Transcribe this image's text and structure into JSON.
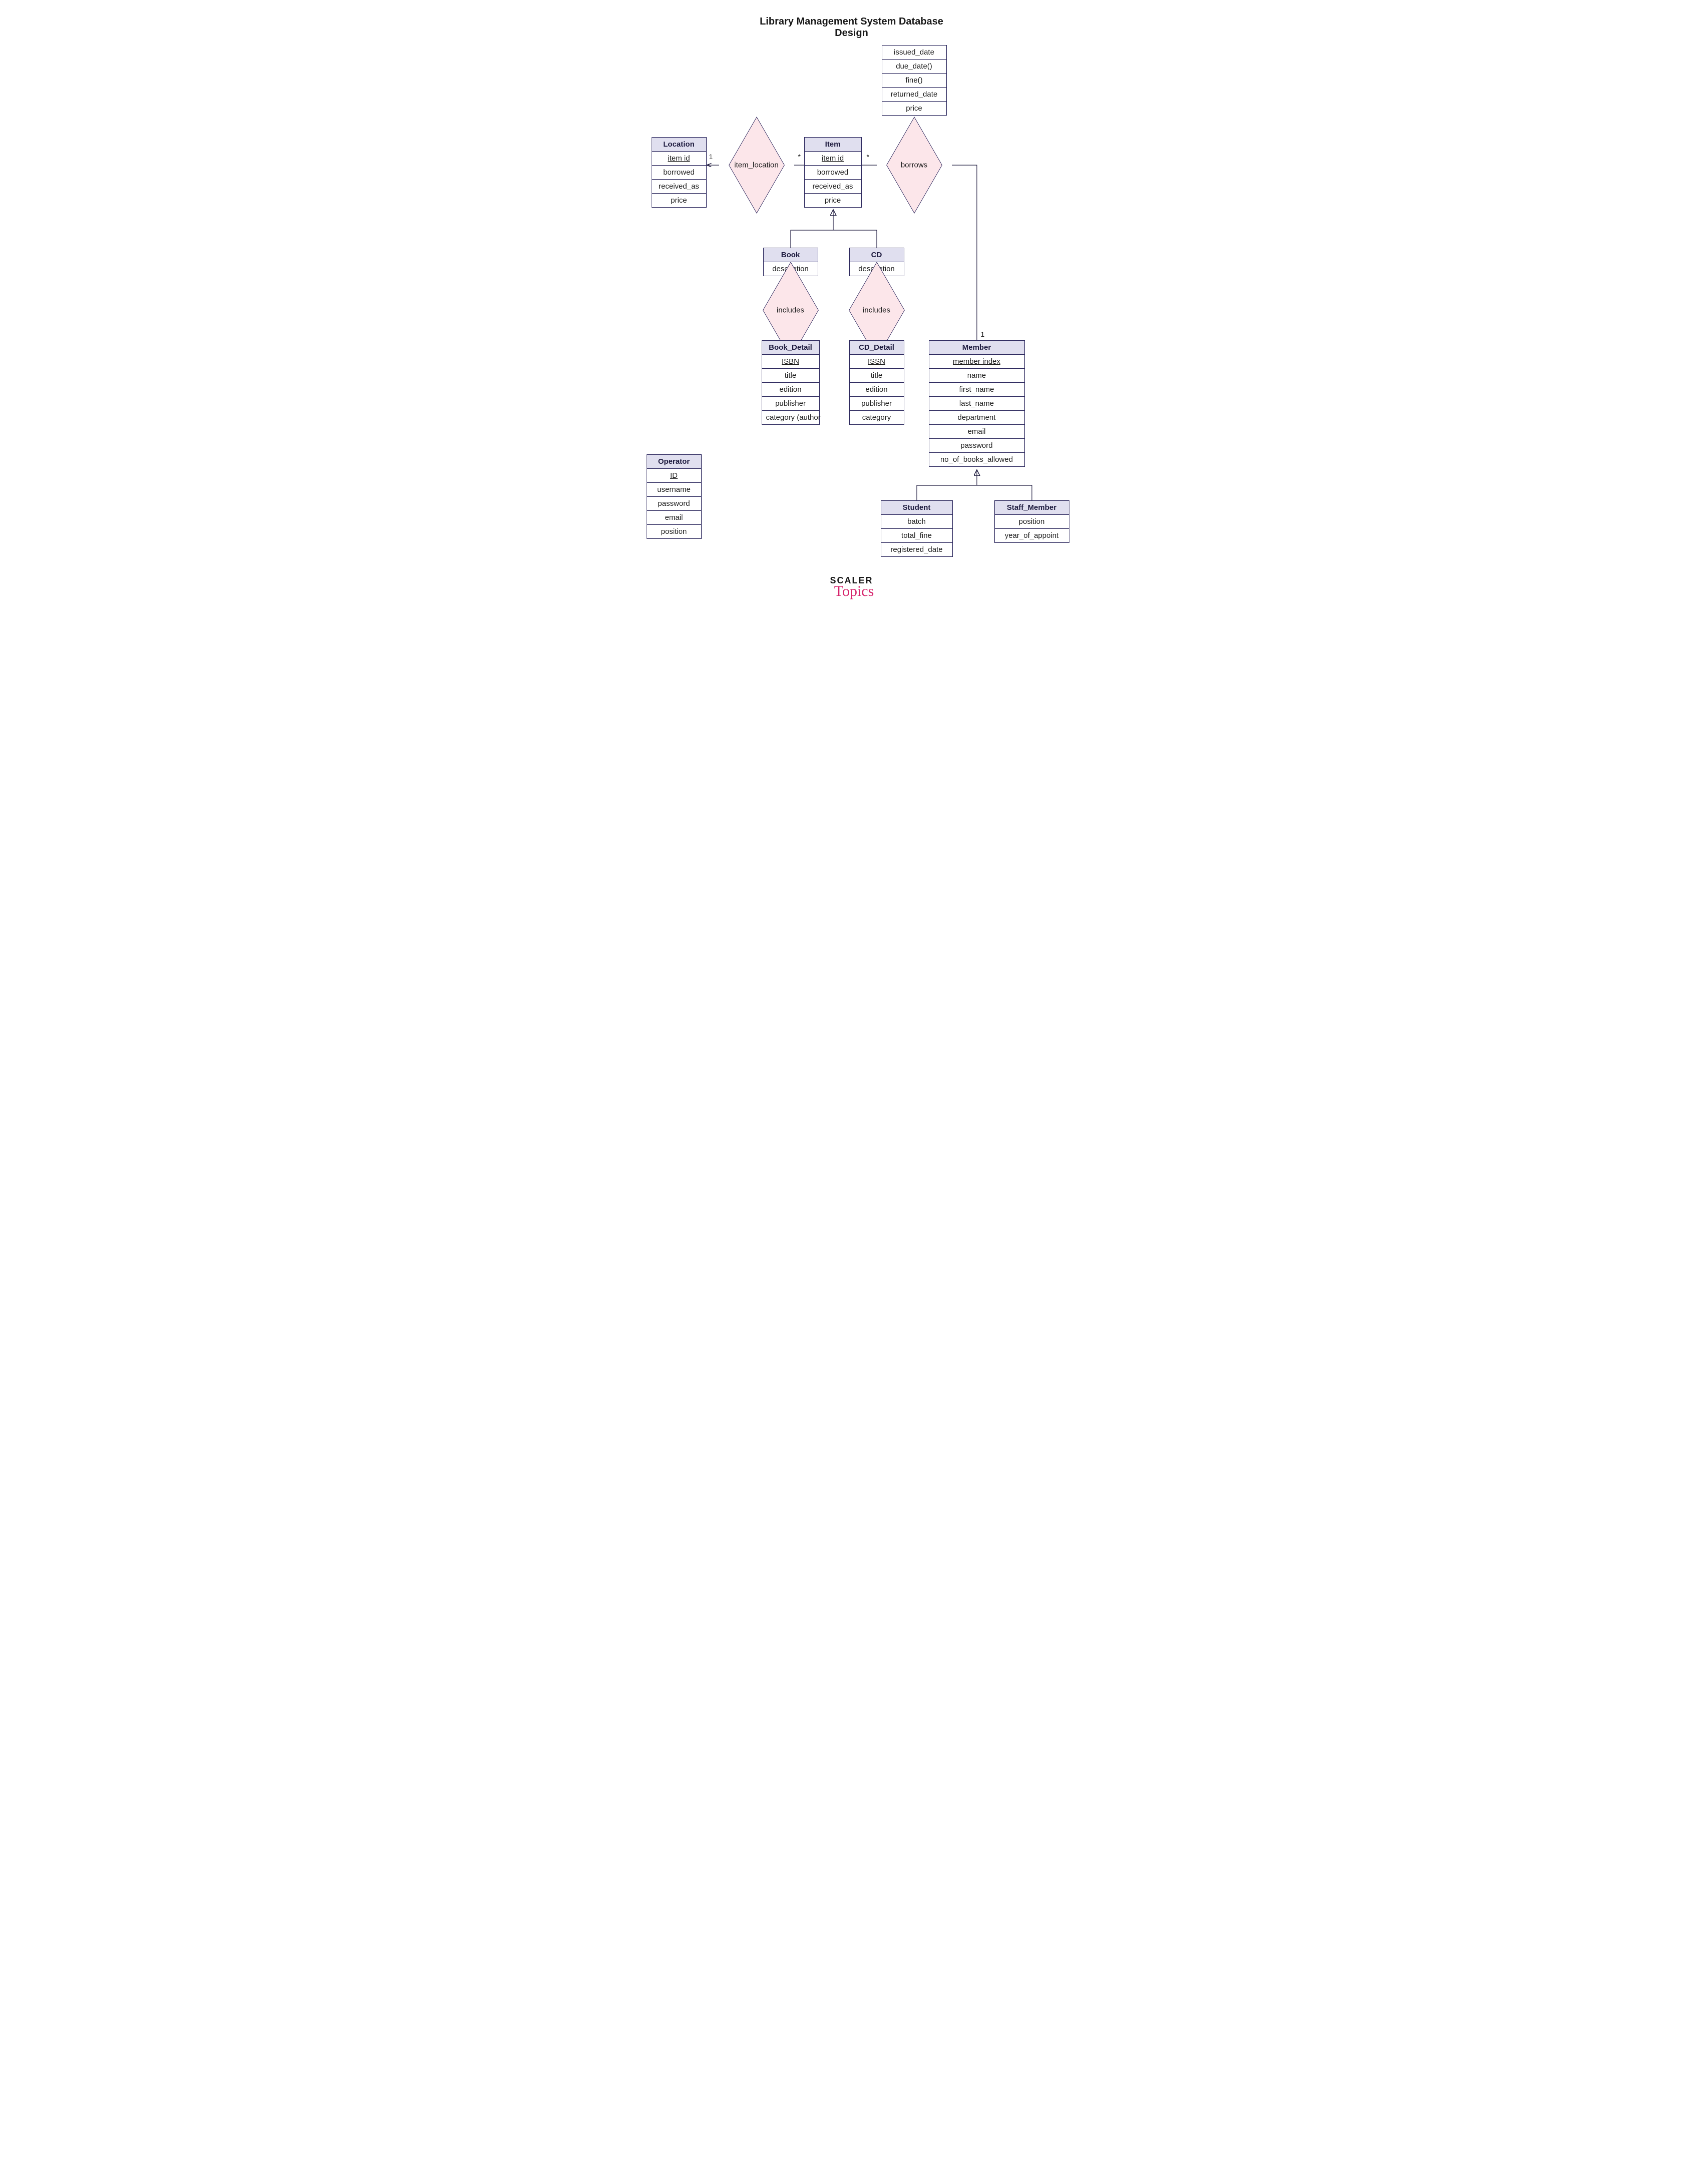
{
  "title": "Library Management System Database Design",
  "entities": {
    "location": {
      "name": "Location",
      "attrs": [
        "item id",
        "borrowed",
        "received_as",
        "price"
      ],
      "keyIndex": 0
    },
    "item": {
      "name": "Item",
      "attrs": [
        "item id",
        "borrowed",
        "received_as",
        "price"
      ],
      "keyIndex": 0
    },
    "book": {
      "name": "Book",
      "attrs": [
        "description"
      ]
    },
    "cd": {
      "name": "CD",
      "attrs": [
        "description"
      ]
    },
    "book_detail": {
      "name": "Book_Detail",
      "attrs": [
        "ISBN",
        "title",
        "edition",
        "publisher",
        "category (author"
      ],
      "keyIndex": 0
    },
    "cd_detail": {
      "name": "CD_Detail",
      "attrs": [
        "ISSN",
        "title",
        "edition",
        "publisher",
        "category"
      ],
      "keyIndex": 0
    },
    "member": {
      "name": "Member",
      "attrs": [
        "member index",
        "name",
        "first_name",
        "last_name",
        "department",
        "email",
        "password",
        "no_of_books_allowed"
      ],
      "keyIndex": 0
    },
    "student": {
      "name": "Student",
      "attrs": [
        "batch",
        "total_fine",
        "registered_date"
      ]
    },
    "staff": {
      "name": "Staff_Member",
      "attrs": [
        "position",
        "year_of_appoint"
      ]
    },
    "operator": {
      "name": "Operator",
      "attrs": [
        "ID",
        "username",
        "password",
        "email",
        "position"
      ],
      "keyIndex": 0
    }
  },
  "borrows_attrs": [
    "issued_date",
    "due_date()",
    "fine()",
    "returned_date",
    "price"
  ],
  "relationships": {
    "item_location": "item_location",
    "borrows": "borrows",
    "includes_book": "includes",
    "includes_cd": "includes"
  },
  "cardinalities": {
    "loc_side": "1",
    "item_side_loc": "*",
    "item_side_borrows": "*",
    "member_side": "1"
  },
  "logo": {
    "line1": "SCALER",
    "line2": "Topics"
  }
}
